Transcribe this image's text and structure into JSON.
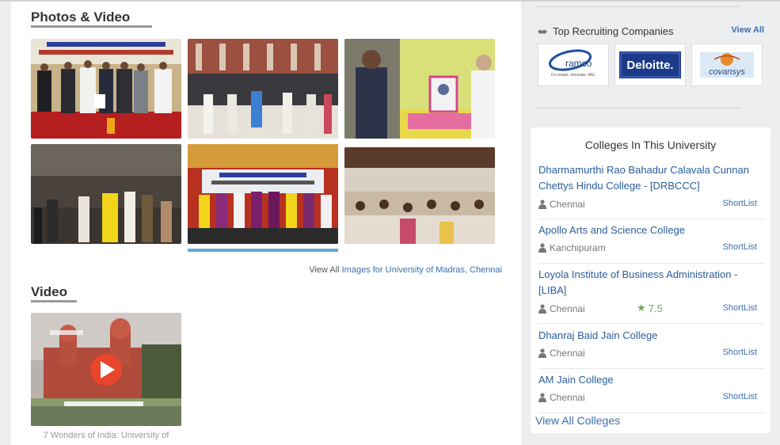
{
  "photos_section": {
    "title": "Photos & Video",
    "view_all_prefix": "View All",
    "view_all_link": "Images for University of Madras, Chennai"
  },
  "video_section": {
    "title": "Video",
    "caption": "7 Wonders of India: University of"
  },
  "recruiters": {
    "title": "Top Recruiting Companies",
    "view_all": "View All",
    "logos": [
      {
        "name": "ramco",
        "tagline": "Co-create. Innovate. Win."
      },
      {
        "name": "Deloitte."
      },
      {
        "name": "covansys"
      }
    ]
  },
  "colleges": {
    "title": "Colleges In This University",
    "shortlist_label": "ShortList",
    "items": [
      {
        "name": "Dharmamurthi Rao Bahadur Calavala Cunnan Chettys Hindu College - [DRBCCC]",
        "location": "Chennai"
      },
      {
        "name": "Apollo Arts and Science College",
        "location": "Kanchipuram"
      },
      {
        "name": "Loyola Institute of Business Administration - [LIBA]",
        "location": "Chennai",
        "rating": "7.5"
      },
      {
        "name": "Dhanraj Baid Jain College",
        "location": "Chennai"
      },
      {
        "name": "AM Jain College",
        "location": "Chennai"
      }
    ],
    "view_all": "View All Colleges"
  },
  "colors": {
    "link": "#3b6fb0",
    "college_link": "#2a5e9c",
    "rating_green": "#6aa84f",
    "play_red": "#e8452c"
  }
}
